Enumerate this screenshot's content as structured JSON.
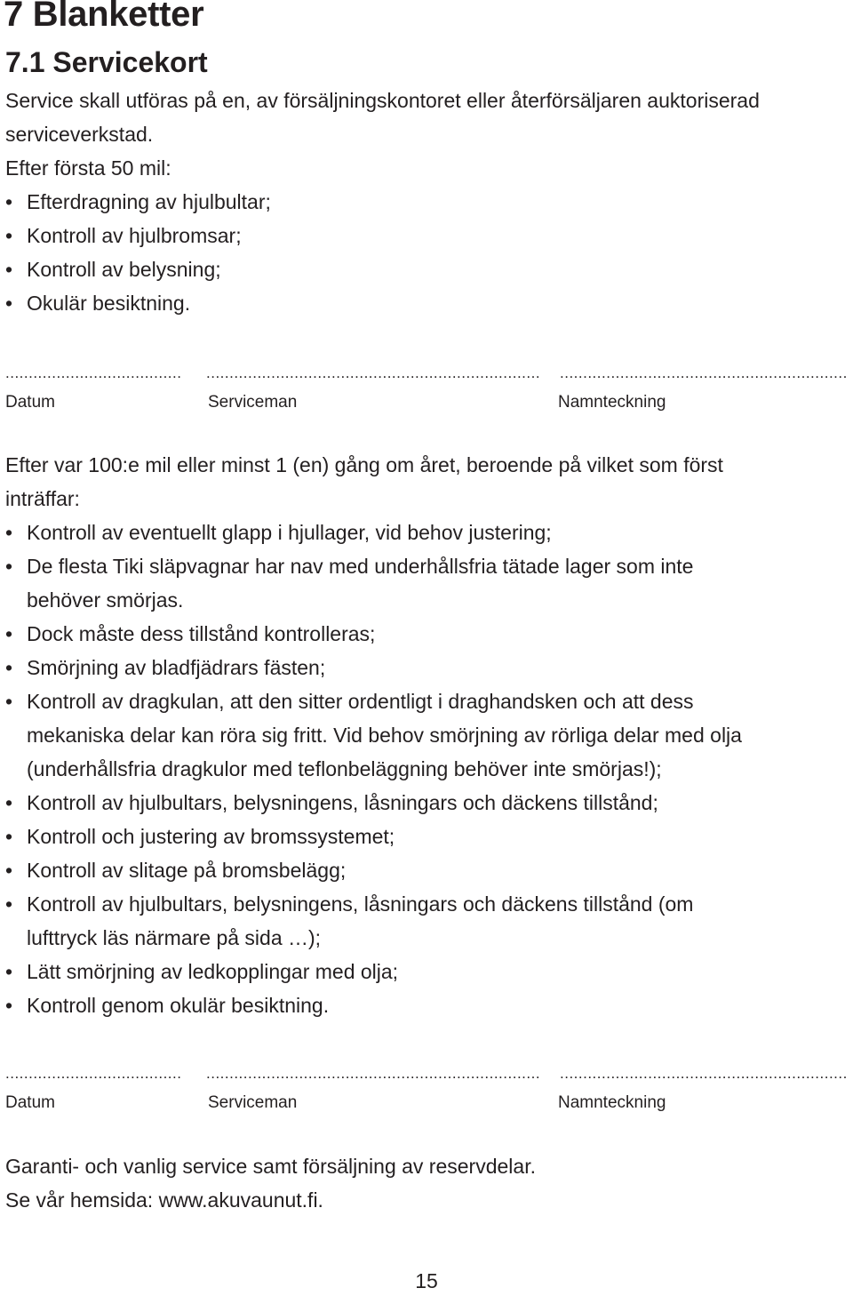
{
  "heading": "7 Blanketter",
  "subheading": "7.1 Servicekort",
  "intro": [
    "Service skall utföras på en, av försäljningskontoret eller återförsäljaren auktoriserad",
    "serviceverkstad.",
    "Efter första 50 mil:"
  ],
  "first_service": {
    "items": [
      "Efterdragning av hjulbultar;",
      "Kontroll av hjulbromsar;",
      "Kontroll av belysning;",
      "Okulär besiktning."
    ]
  },
  "signature": {
    "dots_short": "................................................................",
    "dots_long": "................................................................................................................",
    "labels": {
      "date": "Datum",
      "serviceman": "Serviceman",
      "signature": "Namnteckning"
    }
  },
  "periodic_service": {
    "intro": [
      "Efter var 100:e mil eller minst 1 (en) gång om året, beroende på vilket som först",
      "inträffar:"
    ],
    "items": [
      [
        "Kontroll av eventuellt glapp i hjullager, vid behov justering;"
      ],
      [
        "De flesta Tiki släpvagnar har nav med underhållsfria tätade lager som inte",
        "behöver smörjas."
      ],
      [
        "Dock måste dess tillstånd kontrolleras;"
      ],
      [
        "Smörjning av bladfjädrars fästen;"
      ],
      [
        "Kontroll av dragkulan, att den sitter ordentligt i draghandsken och att dess",
        "mekaniska delar kan röra sig fritt. Vid behov smörjning av rörliga delar med olja",
        "(underhållsfria dragkulor med teflonbeläggning behöver inte smörjas!);"
      ],
      [
        "Kontroll av hjulbultars, belysningens, låsningars och däckens tillstånd;"
      ],
      [
        "Kontroll och justering av bromssystemet;"
      ],
      [
        "Kontroll av slitage på bromsbelägg;"
      ],
      [
        "Kontroll av hjulbultars, belysningens, låsningars och däckens tillstånd (om",
        "lufttryck läs närmare på sida …);"
      ],
      [
        "Lätt smörjning av ledkopplingar med olja;"
      ],
      [
        "Kontroll genom okulär besiktning."
      ]
    ]
  },
  "footer": {
    "line1": "Garanti- och vanlig service samt försäljning av reservdelar.",
    "line2": "Se vår hemsida: www.akuvaunut.fi."
  },
  "page_number": "15"
}
